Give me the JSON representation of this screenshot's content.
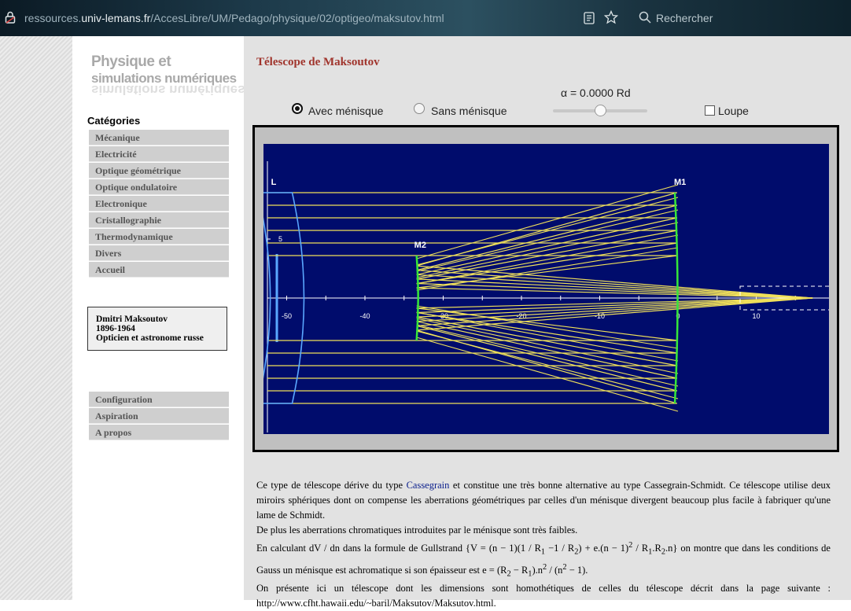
{
  "browser": {
    "url_prefix": "ressources.",
    "url_host": "univ-lemans.fr",
    "url_path": "/AccesLibre/UM/Pedago/physique/02/optigeo/maksutov.html",
    "search_placeholder": "Rechercher",
    "icons": [
      "lock-icon",
      "reader-view-icon",
      "bookmark-star-icon",
      "search-icon"
    ]
  },
  "sidebar": {
    "logo_line1": "Physique et",
    "logo_line2": "simulations numériques",
    "categories_title": "Catégories",
    "items": [
      "Mécanique",
      "Electricité",
      "Optique géométrique",
      "Optique ondulatoire",
      "Electronique",
      "Cristallographie",
      "Thermodynamique",
      "Divers",
      "Accueil"
    ],
    "info": [
      "Dmitri Maksoutov",
      "1896-1964",
      "Opticien et astronome russe"
    ],
    "bottom_items": [
      "Configuration",
      "Aspiration",
      "A propos"
    ]
  },
  "main": {
    "title": "Télescope de Maksoutov",
    "radio_with": "Avec ménisque",
    "radio_without": "Sans ménisque",
    "radio_selected": "with",
    "alpha_label": "α = 0.0000 Rd",
    "alpha_fraction": 0.5,
    "loupe_label": "Loupe",
    "loupe_checked": false
  },
  "simulation": {
    "labels": {
      "lens": "L",
      "mirror1": "M1",
      "mirror2": "M2",
      "tick_5": "5"
    },
    "axis_ticks": [
      "-50",
      "-40",
      "-30",
      "-20",
      "-10",
      "0",
      "10"
    ],
    "colors": {
      "background": "#000c6c",
      "rays": "#f0e05a",
      "mirrors": "#36e63a",
      "lens": "#5aa7ff",
      "axis": "#ffffff"
    }
  },
  "description": {
    "p1_before": "Ce type de télescope dérive du type ",
    "p1_link": "Cassegrain",
    "p1_after": " et constitue une très bonne alternative au type Cassegrain-Schmidt. Ce télescope utilise deux miroirs sphériques dont on compense les aberrations géométriques par celles d'un ménisque divergent beaucoup plus facile à fabriquer qu'une lame de Schmidt.",
    "p2": "De plus les aberrations chromatiques introduites par le ménisque sont très faibles.",
    "p3a": "En calculant dV / dn dans la formule de Gullstrand {V = (n − 1)(1 / R",
    "p3b": " −1 / R",
    "p3c": ") + e.(n − 1)",
    "p3d": " / R",
    "p3e": ".R",
    "p3f": ".n} on montre que dans les conditions de Gauss un ménisque est achromatique si son épaisseur est e = (R",
    "p3g": " − R",
    "p3h": ").n",
    "p3i": " / (n",
    "p3j": " − 1).",
    "sub1": "1",
    "sub2": "2",
    "sup2": "2",
    "p4": "On présente ici un télescope dont les dimensions sont homothétiques de celles du télescope décrit dans la page suivante : http://www.cfht.hawaii.edu/~baril/Maksutov/Maksutov.html."
  }
}
